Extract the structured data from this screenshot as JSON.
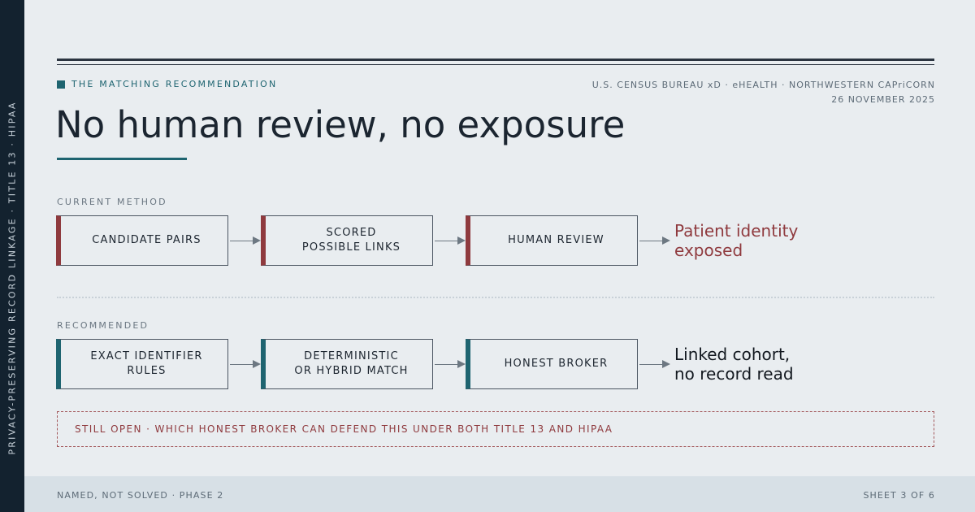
{
  "sidebar": {
    "text": "PRIVACY-PRESERVING RECORD LINKAGE · TITLE 13 · HIPAA"
  },
  "header": {
    "eyebrow": "THE MATCHING RECOMMENDATION",
    "meta_line1": "U.S. CENSUS BUREAU xD · eHEALTH · NORTHWESTERN CAPriCORN",
    "meta_line2": "26 NOVEMBER 2025",
    "title": "No human review, no exposure"
  },
  "current": {
    "label": "CURRENT METHOD",
    "steps": [
      "CANDIDATE PAIRS",
      "SCORED\nPOSSIBLE LINKS",
      "HUMAN REVIEW"
    ],
    "outcome": "Patient identity\nexposed",
    "accent": "#8f3a3e"
  },
  "recommended": {
    "label": "RECOMMENDED",
    "steps": [
      "EXACT IDENTIFIER\nRULES",
      "DETERMINISTIC\nOR HYBRID MATCH",
      "HONEST BROKER"
    ],
    "outcome": "Linked cohort,\nno record read",
    "accent": "#1e6470"
  },
  "open_question": "STILL OPEN · WHICH HONEST BROKER CAN DEFEND THIS UNDER BOTH TITLE 13 AND HIPAA",
  "footer": {
    "left": "NAMED, NOT SOLVED · PHASE 2",
    "right": "SHEET 3 OF 6"
  }
}
